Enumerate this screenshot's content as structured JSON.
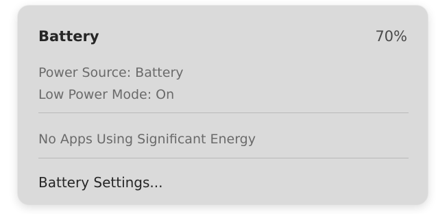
{
  "battery_menu": {
    "title": "Battery",
    "percentage": "70%",
    "power_source": "Power Source: Battery",
    "low_power_mode": "Low Power Mode: On",
    "apps_status": "No Apps Using Significant Energy",
    "settings_label": "Battery Settings..."
  }
}
